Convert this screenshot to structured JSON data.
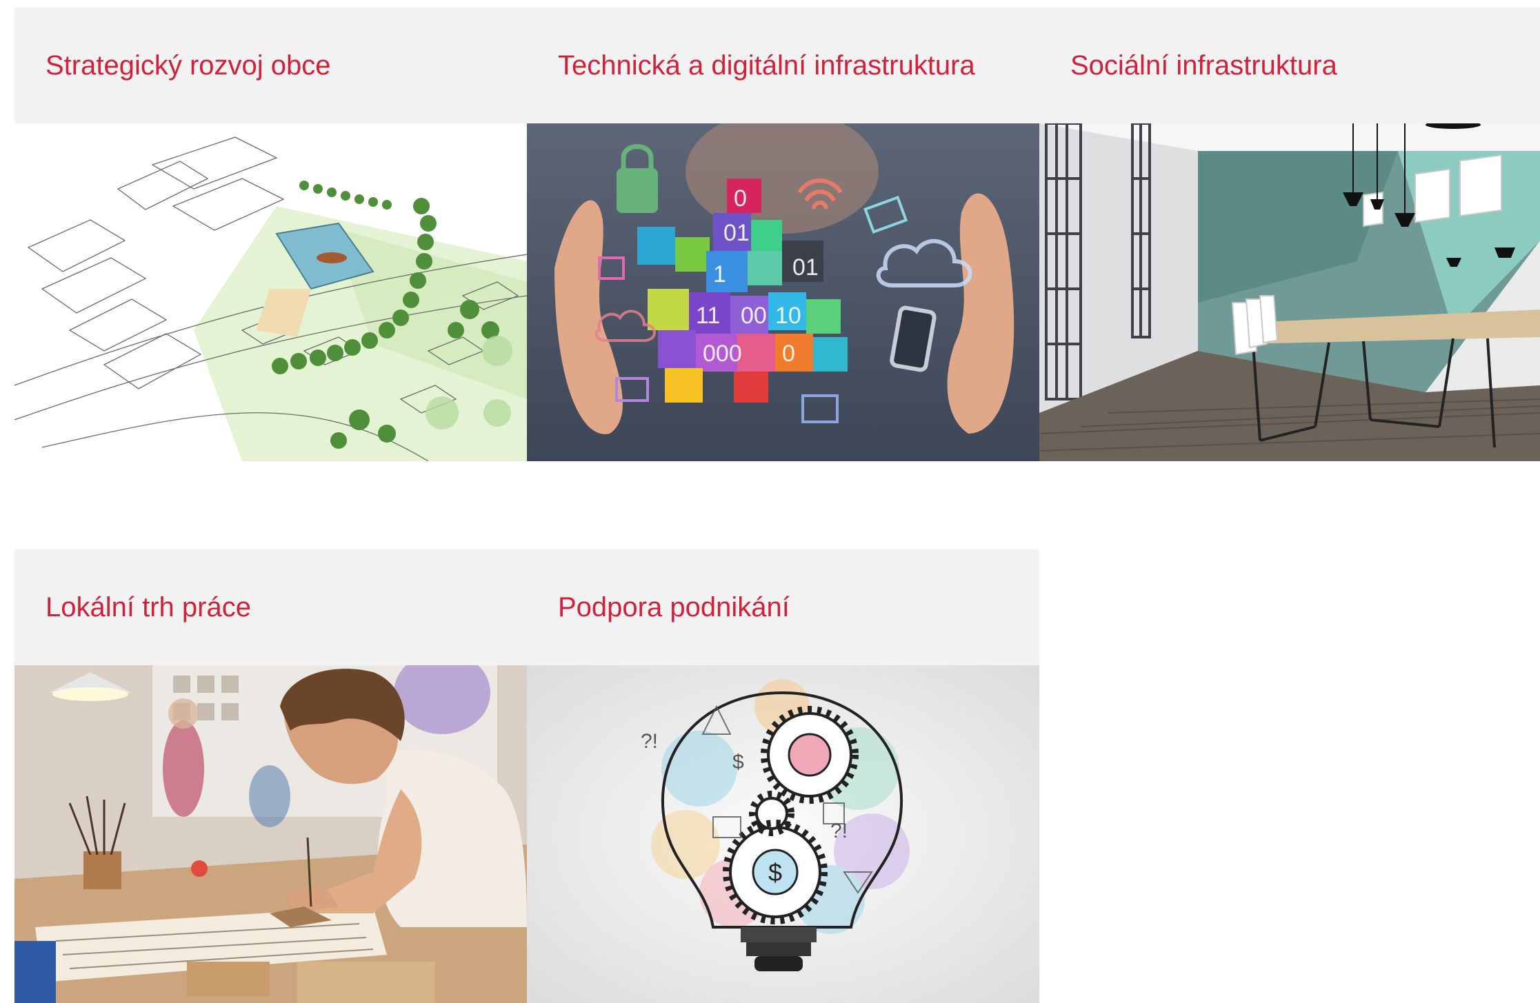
{
  "cards": [
    {
      "title": "Strategický rozvoj obce",
      "image": "urban-plan-sketch-image"
    },
    {
      "title": "Technická a digitální infrastruktura",
      "image": "digital-cubes-hands-image"
    },
    {
      "title": "Sociální infrastruktura",
      "image": "office-interior-image"
    },
    {
      "title": "Lokální trh práce",
      "image": "student-drawing-workshop-image"
    },
    {
      "title": "Podpora podnikání",
      "image": "lightbulb-gears-sketch-image"
    }
  ],
  "colors": {
    "title_accent": "#d3203a",
    "header_background": "#f2f2f2"
  }
}
